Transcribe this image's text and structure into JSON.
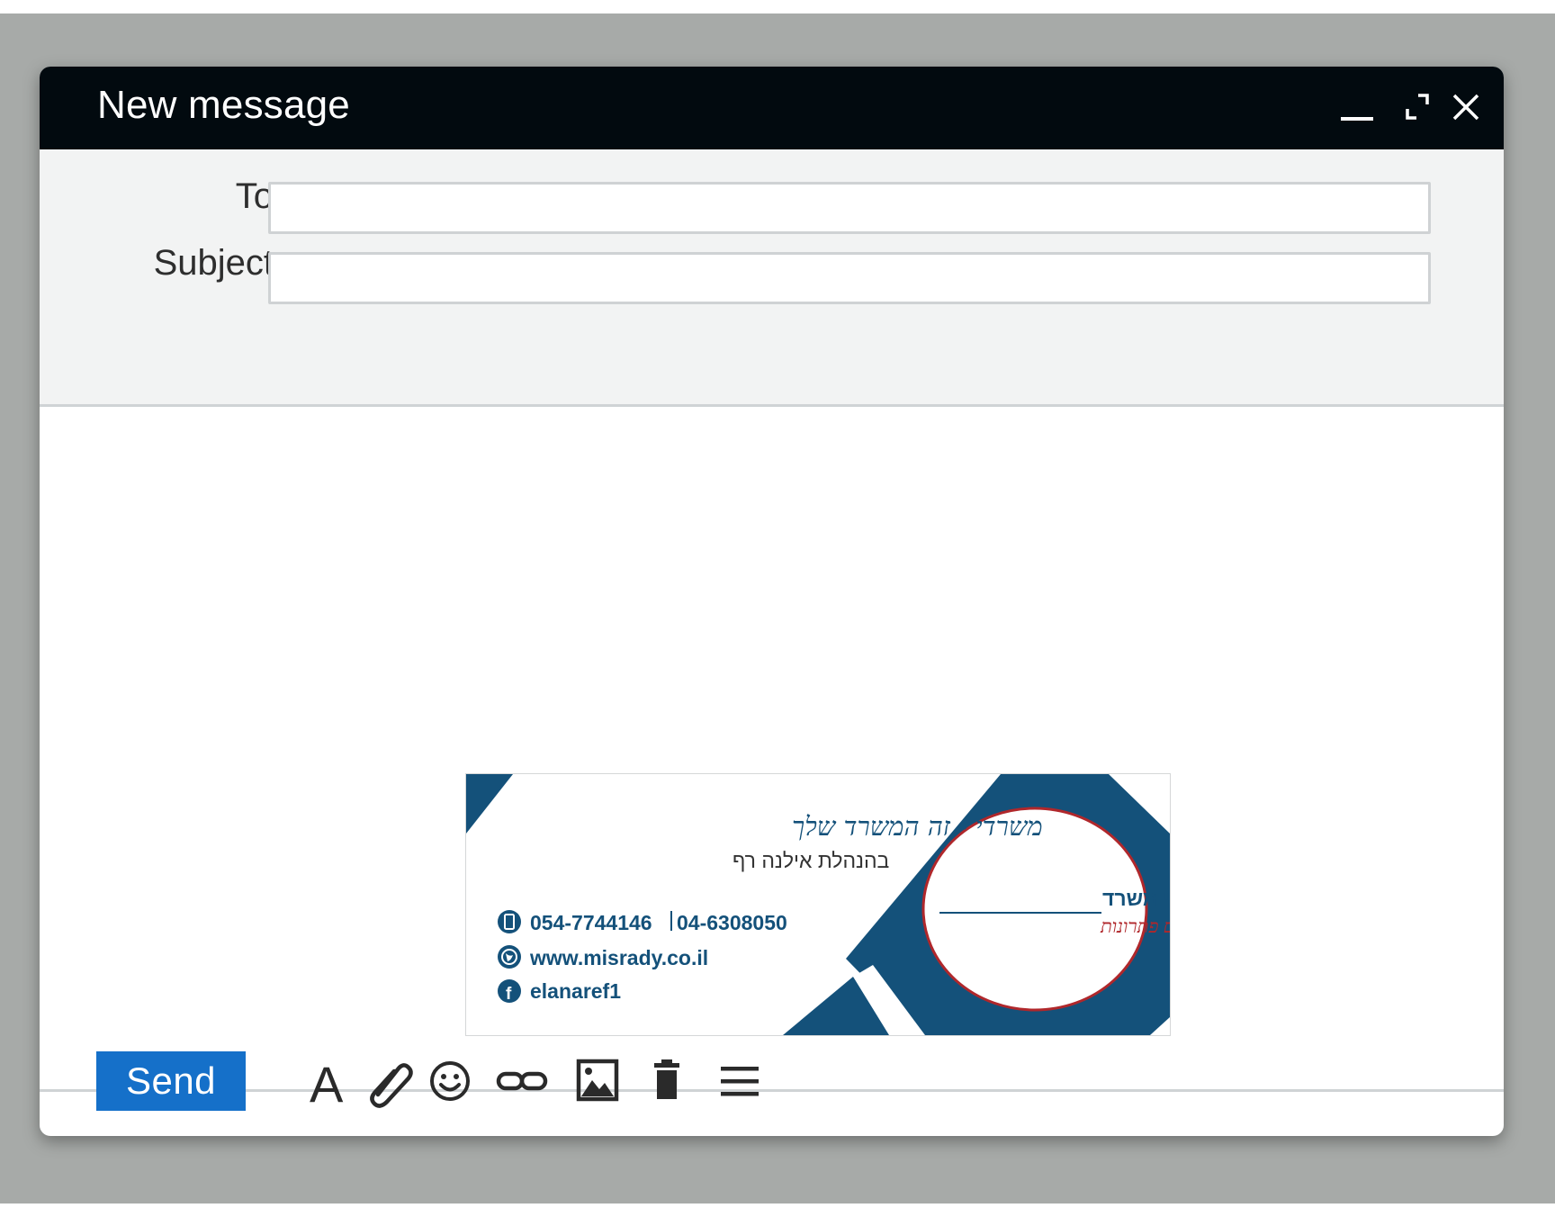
{
  "window": {
    "title": "New message",
    "controls": [
      "minimize-icon",
      "expand-icon",
      "close-icon"
    ]
  },
  "fields": {
    "to_label": "To",
    "to_value": "",
    "subject_label": "Subject",
    "subject_value": ""
  },
  "signature": {
    "slogan": "משרדי - זה המשרד שלך",
    "manager": "בהנהלת אילנה רף",
    "mobile": "054-7744146",
    "phone": "04-6308050",
    "website": "www.misrady.co.il",
    "facebook": "elanaref1",
    "logo_title": "משרדי– שירותי משרד",
    "logo_tagline": "יוצרים עבורכם פתרונות",
    "colors": {
      "primary": "#14517a",
      "accent": "#b0272b"
    }
  },
  "toolbar": {
    "send_label": "Send",
    "tools": [
      "text-format-icon",
      "attach-icon",
      "emoji-icon",
      "link-icon",
      "image-icon",
      "trash-icon",
      "more-options-icon"
    ]
  },
  "colors": {
    "titlebar": "#020a0f",
    "send": "#1570c9",
    "backdrop": "#a7aaa8"
  }
}
